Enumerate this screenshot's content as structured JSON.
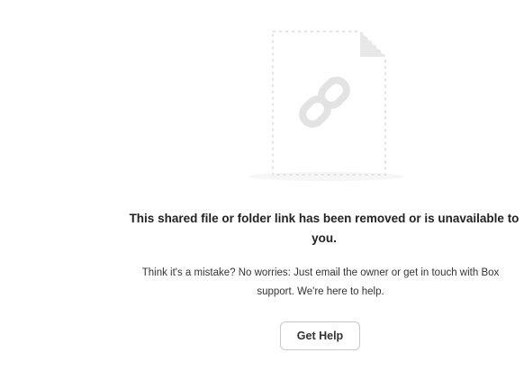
{
  "illustration": {
    "icon": "broken-link-file-icon",
    "stroke_color": "#e3e3e3"
  },
  "error": {
    "title": "This shared file or folder link has been removed or is unavailable to you.",
    "message": "Think it's a mistake? No worries: Just email the owner or get in touch with Box support. We're here to help."
  },
  "actions": {
    "help_label": "Get Help"
  }
}
